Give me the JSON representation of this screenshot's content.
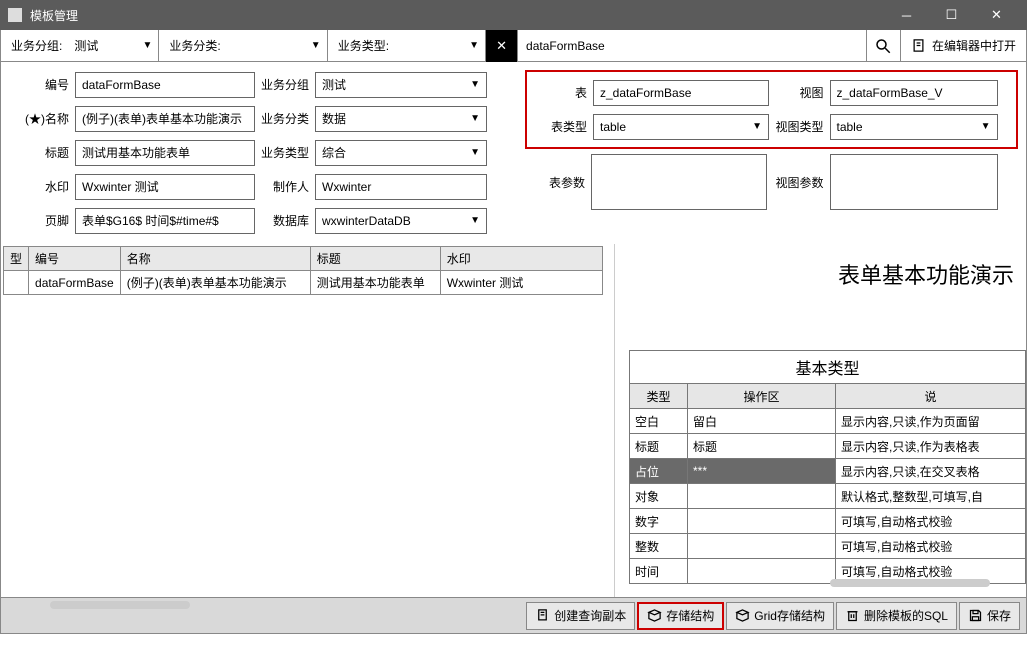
{
  "window": {
    "title": "模板管理"
  },
  "toolbar": {
    "group_label": "业务分组:",
    "group_value": "测试",
    "class_label": "业务分类:",
    "class_value": "",
    "type_label": "业务类型:",
    "type_value": "",
    "search_value": "dataFormBase",
    "open_label": "在编辑器中打开"
  },
  "form": {
    "id_label": "编号",
    "id_value": "dataFormBase",
    "name_label": "(★)名称",
    "name_value": "(例子)(表单)表单基本功能演示",
    "title_label": "标题",
    "title_value": "测试用基本功能表单",
    "watermark_label": "水印",
    "watermark_value": "Wxwinter 测试",
    "footer_label": "页脚",
    "footer_value": "表单$G16$ 时间$#time#$",
    "group_label": "业务分组",
    "group_value": "测试",
    "class_label": "业务分类",
    "class_value": "数据",
    "type_label": "业务类型",
    "type_value": "综合",
    "maker_label": "制作人",
    "maker_value": "Wxwinter",
    "db_label": "数据库",
    "db_value": "wxwinterDataDB"
  },
  "right": {
    "table_label": "表",
    "table_value": "z_dataFormBase",
    "tabletype_label": "表类型",
    "tabletype_value": "table",
    "tableparams_label": "表参数",
    "view_label": "视图",
    "view_value": "z_dataFormBase_V",
    "viewtype_label": "视图类型",
    "viewtype_value": "table",
    "viewparams_label": "视图参数"
  },
  "list": {
    "cols": [
      "型",
      "编号",
      "名称",
      "标题",
      "水印"
    ],
    "row": [
      "",
      "dataFormBase",
      "(例子)(表单)表单基本功能演示",
      "测试用基本功能表单",
      "Wxwinter 测试"
    ]
  },
  "preview": {
    "title": "表单基本功能演示",
    "caption": "基本类型",
    "headers": [
      "类型",
      "操作区",
      "说"
    ],
    "rows": [
      {
        "c": [
          "空白",
          "留白",
          "显示内容,只读,作为页面留"
        ]
      },
      {
        "c": [
          "标题",
          "标题",
          "显示内容,只读,作为表格表"
        ]
      },
      {
        "c": [
          "占位",
          "***",
          "显示内容,只读,在交叉表格"
        ],
        "dark": true
      },
      {
        "c": [
          "对象",
          "",
          "默认格式,整数型,可填写,自"
        ]
      },
      {
        "c": [
          "数字",
          "",
          "可填写,自动格式校验"
        ]
      },
      {
        "c": [
          "整数",
          "",
          "可填写,自动格式校验"
        ]
      },
      {
        "c": [
          "时间",
          "",
          "可填写,自动格式校验"
        ]
      }
    ]
  },
  "footer": {
    "b1": "创建查询副本",
    "b2": "存储结构",
    "b3": "Grid存储结构",
    "b4": "删除模板的SQL",
    "b5": "保存"
  }
}
